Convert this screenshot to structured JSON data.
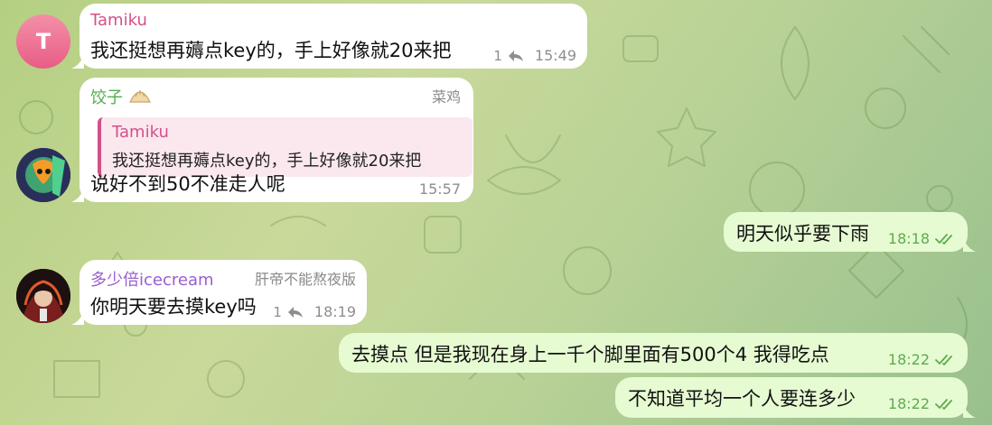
{
  "colors": {
    "tamiku_name": "#d4508a",
    "jiaozi_name": "#4fae4f",
    "duoshaobei_name": "#9a5ed0",
    "outgoing_bubble": "#e6fbd2",
    "incoming_bubble": "#ffffff",
    "read_check": "#5dab4f"
  },
  "messages": [
    {
      "sender": "Tamiku",
      "avatar_letter": "T",
      "text": "我还挺想再薅点key的，手上好像就20来把",
      "reply_count": "1",
      "time": "15:49"
    },
    {
      "sender": "饺子",
      "badge": "菜鸡",
      "reply_to": {
        "sender": "Tamiku",
        "text": "我还挺想再薅点key的，手上好像就20来把"
      },
      "text": "说好不到50不准走人呢",
      "time": "15:57"
    },
    {
      "outgoing": true,
      "text": "明天似乎要下雨",
      "time": "18:18"
    },
    {
      "sender": "多少倍icecream",
      "badge": "肝帝不能熬夜版",
      "text": "你明天要去摸key吗",
      "reply_count": "1",
      "time": "18:19"
    },
    {
      "outgoing": true,
      "text": "去摸点 但是我现在身上一千个脚里面有500个4 我得吃点",
      "time": "18:22"
    },
    {
      "outgoing": true,
      "text": "不知道平均一个人要连多少",
      "time": "18:22"
    }
  ]
}
